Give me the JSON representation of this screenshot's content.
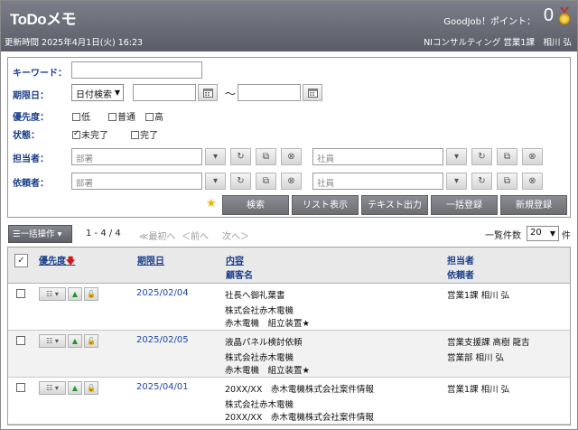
{
  "header": {
    "title": "ToDoメモ",
    "points_label": "GoodJob！ポイント：",
    "points_value": "0",
    "updated": "更新時間 2025年4月1日(火) 16:23",
    "org": "NIコンサルティング 営業1課　相川 弘"
  },
  "search": {
    "keyword_label": "キーワード：",
    "due_label": "期限日：",
    "due_mode": "日付検索",
    "tilde": "～",
    "priority_label": "優先度：",
    "priority_options": [
      "低",
      "普通",
      "高"
    ],
    "status_label": "状態：",
    "status_options": [
      {
        "label": "未完了",
        "checked": true
      },
      {
        "label": "完了",
        "checked": false
      }
    ],
    "assignee_label": "担当者：",
    "requester_label": "依頼者：",
    "dept_placeholder": "部署",
    "staff_placeholder": "社員",
    "buttons": {
      "search": "検索",
      "list": "リスト表示",
      "text_export": "テキスト出力",
      "bulk_register": "一括登録",
      "new_register": "新規登録"
    }
  },
  "list": {
    "bulk_label": "一括操作",
    "range": "1 - 4 / 4",
    "first": "≪最初へ",
    "prev": "＜前へ",
    "next": "次へ＞",
    "per_page_label": "一覧件数",
    "per_page": "20",
    "per_page_unit": "件",
    "headers": {
      "priority": "優先度",
      "due": "期限日",
      "content": "内容",
      "customer": "顧客名",
      "assignee": "担当者",
      "requester": "依頼者"
    },
    "rows": [
      {
        "date": "2025/02/04",
        "content": "社長へ御礼葉書",
        "customer": "株式会社赤木電機",
        "project": "赤木電機　組立装置★",
        "assignee": "営業1課 相川 弘",
        "requester": ""
      },
      {
        "date": "2025/02/05",
        "content": "液晶パネル検討依頼",
        "customer": "株式会社赤木電機",
        "project": "赤木電機　組立装置★",
        "assignee": "営業支援課 高樹 龍吉",
        "requester": "営業部 相川 弘"
      },
      {
        "date": "2025/04/01",
        "content": "20XX/XX　赤木電機株式会社案件情報",
        "customer": "株式会社赤木電機",
        "project": "20XX/XX　赤木電機株式会社案件情報",
        "assignee": "営業1課 相川 弘",
        "requester": ""
      }
    ]
  },
  "colors": {
    "header_bg": "#6a6d76",
    "label_blue": "#1b3f8a",
    "link_blue": "#1f49a8",
    "button_gray": "#7a7c82",
    "star": "#f0b400",
    "sort_red": "#d01818"
  }
}
